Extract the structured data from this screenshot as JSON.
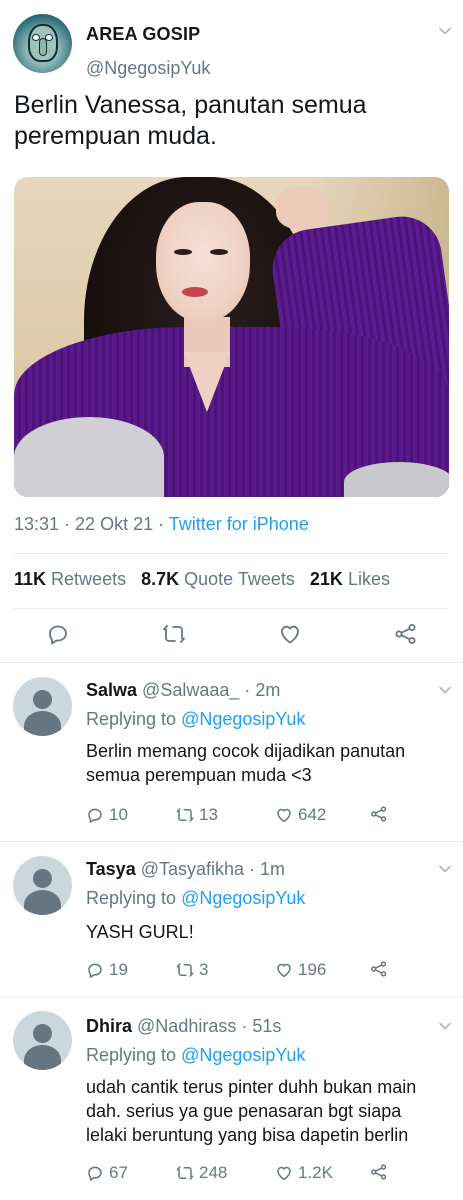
{
  "main_tweet": {
    "display_name": "AREA GOSIP",
    "handle": "@NgegosipYuk",
    "text": "Berlin Vanessa, panutan semua perempuan muda.",
    "avatar_icon": "squidward-avatar",
    "media_description": "photo",
    "time": "13:31 · 22 Okt 21 · ",
    "source": "Twitter for iPhone",
    "stats": {
      "retweets_count": "11K",
      "retweets_label": "Retweets",
      "quotes_count": "8.7K",
      "quotes_label": "Quote Tweets",
      "likes_count": "21K",
      "likes_label": "Likes"
    },
    "actions": [
      "reply-icon",
      "retweet-icon",
      "like-icon",
      "share-icon"
    ]
  },
  "replies": [
    {
      "name": "Salwa",
      "handle": "@Salwaaa_",
      "time": " · 2m",
      "replying_prefix": "Replying to ",
      "replying_to": "@NgegosipYuk",
      "text": "Berlin memang cocok dijadikan panutan semua perempuan muda <3",
      "replies": "10",
      "retweets": "13",
      "likes": "642"
    },
    {
      "name": "Tasya",
      "handle": "@Tasyafikha",
      "time": " · 1m",
      "replying_prefix": "Replying to ",
      "replying_to": "@NgegosipYuk",
      "text": "YASH GURL!",
      "replies": "19",
      "retweets": "3",
      "likes": "196"
    },
    {
      "name": "Dhira",
      "handle": "@Nadhirass",
      "time": " · 51s",
      "replying_prefix": "Replying to ",
      "replying_to": "@NgegosipYuk",
      "text": "udah cantik terus pinter duhh bukan main dah. serius ya gue penasaran bgt siapa lelaki beruntung yang bisa dapetin berlin",
      "replies": "67",
      "retweets": "248",
      "likes": "1.2K"
    }
  ],
  "colors": {
    "accent": "#1da1f2",
    "secondary_text": "#657786",
    "primary_text": "#14171a",
    "divider": "#e6ecf0"
  }
}
